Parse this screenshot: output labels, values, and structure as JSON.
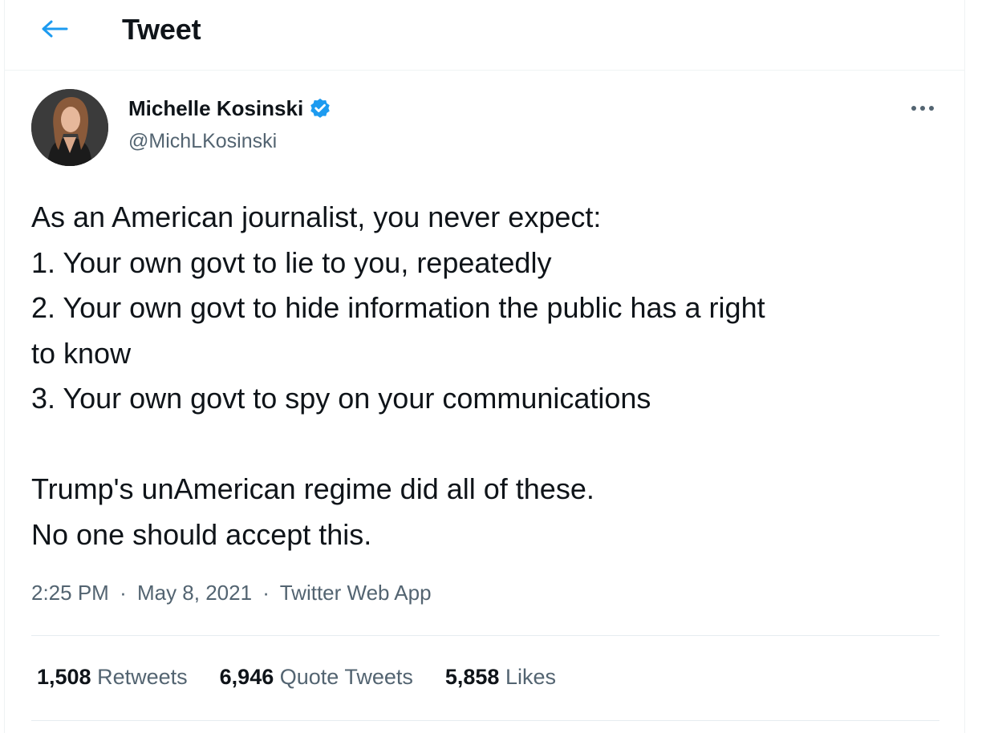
{
  "header": {
    "title": "Tweet",
    "back_icon": "arrow-left-icon",
    "accent": "#1d9bf0"
  },
  "author": {
    "name": "Michelle Kosinski",
    "handle": "@MichLKosinski",
    "verified_icon": "verified-badge-icon",
    "more_icon": "more-horizontal-icon"
  },
  "tweet": {
    "lines": [
      "As an American journalist, you never expect:",
      "1. Your own govt to lie to you, repeatedly",
      "2. Your own govt to hide information the public has a right",
      "to know",
      "3. Your own govt to spy on your communications",
      "",
      "Trump's unAmerican regime did all of these.",
      "No one should accept this."
    ]
  },
  "meta": {
    "time": "2:25 PM",
    "separator": "·",
    "date": "May 8, 2021",
    "source": "Twitter Web App"
  },
  "stats": {
    "retweets_count": "1,508",
    "retweets_label": "Retweets",
    "quotes_count": "6,946",
    "quotes_label": "Quote Tweets",
    "likes_count": "5,858",
    "likes_label": "Likes"
  }
}
